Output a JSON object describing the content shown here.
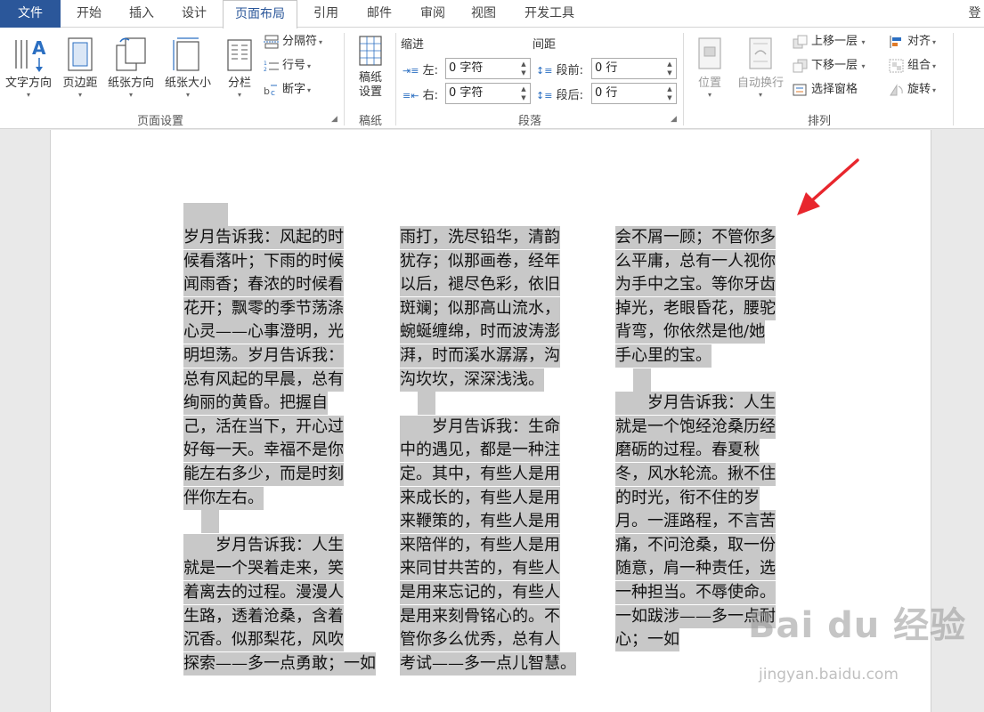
{
  "tabs": [
    "文件",
    "开始",
    "插入",
    "设计",
    "页面布局",
    "引用",
    "邮件",
    "审阅",
    "视图",
    "开发工具"
  ],
  "active_tab": "页面布局",
  "corner_glyph": "登",
  "ribbon": {
    "page_setup": {
      "label": "页面设置",
      "text_direction": "文字方向",
      "margins": "页边距",
      "orientation": "纸张方向",
      "size": "纸张大小",
      "columns": "分栏",
      "breaks": "分隔符",
      "line_numbers": "行号",
      "hyphenation": "断字"
    },
    "manuscript": {
      "label": "稿纸",
      "button_line1": "稿纸",
      "button_line2": "设置"
    },
    "paragraph": {
      "label": "段落",
      "indent_header": "缩进",
      "spacing_header": "间距",
      "left_label": "左:",
      "left_value": "0 字符",
      "right_label": "右:",
      "right_value": "0 字符",
      "before_label": "段前:",
      "before_value": "0 行",
      "after_label": "段后:",
      "after_value": "0 行"
    },
    "arrange": {
      "label": "排列",
      "position": "位置",
      "wrap_text": "自动换行",
      "bring_forward": "上移一层",
      "send_backward": "下移一层",
      "selection_pane": "选择窗格",
      "align": "对齐",
      "group": "组合",
      "rotate": "旋转"
    }
  },
  "document": {
    "column1": [
      "岁月告诉我：风起的时",
      "候看落叶；下雨的时候",
      "闻雨香；春浓的时候看",
      "花开；飘零的季节荡涤",
      "心灵——心事澄明，光",
      "明坦荡。岁月告诉我：",
      "总有风起的早晨，总有",
      "绚丽的黄昏。把握自",
      "己，活在当下，开心过",
      "好每一天。幸福不是你",
      "能左右多少，而是时刻",
      "伴你左右。",
      "",
      "    岁月告诉我：人生",
      "就是一个哭着走来，笑",
      "着离去的过程。漫漫人",
      "生路，透着沧桑，含着",
      "沉香。似那梨花，风吹",
      "探索——多一点勇敢；一如"
    ],
    "column2": [
      "雨打，洗尽铅华，清韵",
      "犹存；似那画卷，经年",
      "以后，褪尽色彩，依旧",
      "斑斓；似那高山流水，",
      "蜿蜒缠绵，时而波涛澎",
      "湃，时而溪水潺潺，沟",
      "沟坎坎，深深浅浅。",
      "",
      "    岁月告诉我：生命",
      "中的遇见，都是一种注",
      "定。其中，有些人是用",
      "来成长的，有些人是用",
      "来鞭策的，有些人是用",
      "来陪伴的，有些人是用",
      "来同甘共苦的，有些人",
      "是用来忘记的，有些人",
      "是用来刻骨铭心的。不",
      "管你多么优秀，总有人",
      "考试——多一点儿智慧。"
    ],
    "column3": [
      "会不屑一顾；不管你多",
      "么平庸，总有一人视你",
      "为手中之宝。等你牙齿",
      "掉光，老眼昏花，腰驼",
      "背弯，你依然是他/她",
      "手心里的宝。",
      "",
      "    岁月告诉我：人生",
      "就是一个饱经沧桑历经",
      "磨砺的过程。春夏秋",
      "冬，风水轮流。揪不住",
      "的时光，衔不住的岁",
      "月。一涯路程，不言苦",
      "痛，不问沧桑，取一份",
      "随意，肩一种责任，选",
      "一种担当。不辱使命。",
      "一如跋涉——多一点耐",
      "心；一如"
    ]
  },
  "watermark": {
    "brand": "Bai du 经验",
    "url": "jingyan.baidu.com"
  },
  "colors": {
    "file_tab": "#2b579a",
    "highlight": "#c8c8c8",
    "arrow": "#e8262d"
  }
}
